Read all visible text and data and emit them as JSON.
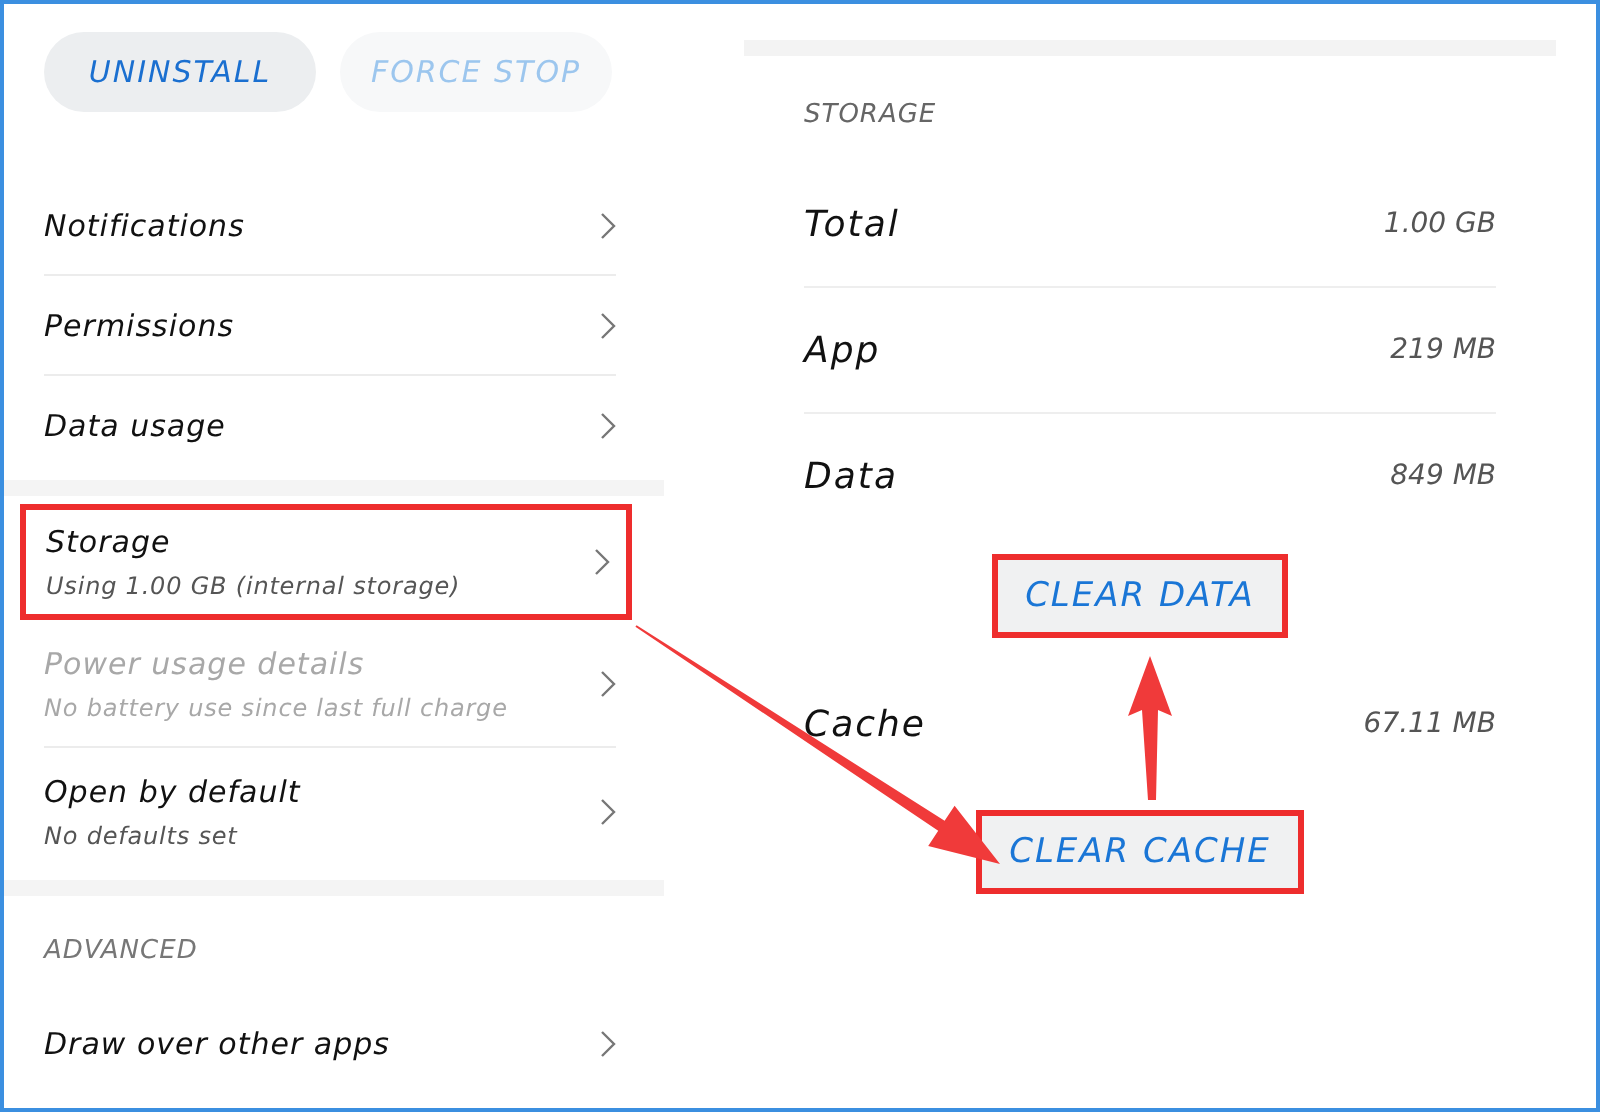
{
  "actions": [
    {
      "label": "UNINSTALL",
      "disabled": false
    },
    {
      "label": "FORCE STOP",
      "disabled": true
    }
  ],
  "settings_groups": [
    {
      "items": [
        {
          "title": "Notifications",
          "disabled": false,
          "highlighted": false
        },
        {
          "title": "Permissions",
          "disabled": false,
          "highlighted": false
        },
        {
          "title": "Data usage",
          "disabled": false,
          "highlighted": false
        }
      ]
    },
    {
      "items": [
        {
          "title": "Storage",
          "subtitle": "Using 1.00 GB (internal storage)",
          "disabled": false,
          "highlighted": true
        },
        {
          "title": "Power usage details",
          "subtitle": "No battery use since last full charge",
          "disabled": true,
          "highlighted": false
        },
        {
          "title": "Open by default",
          "subtitle": "No defaults set",
          "disabled": false,
          "highlighted": false
        }
      ]
    },
    {
      "header": "ADVANCED",
      "items": [
        {
          "title": "Draw over other apps",
          "disabled": false,
          "highlighted": false
        }
      ]
    }
  ],
  "storage": {
    "header": "STORAGE",
    "rows": [
      {
        "label": "Total",
        "value": "1.00 GB"
      },
      {
        "label": "App",
        "value": "219 MB"
      },
      {
        "label": "Data",
        "value": "849 MB"
      }
    ],
    "clear_data_button": {
      "label": "CLEAR DATA",
      "highlighted": true
    },
    "cache": {
      "label": "Cache",
      "value": "67.11 MB"
    },
    "clear_cache_button": {
      "label": "CLEAR CACHE",
      "highlighted": true
    }
  }
}
